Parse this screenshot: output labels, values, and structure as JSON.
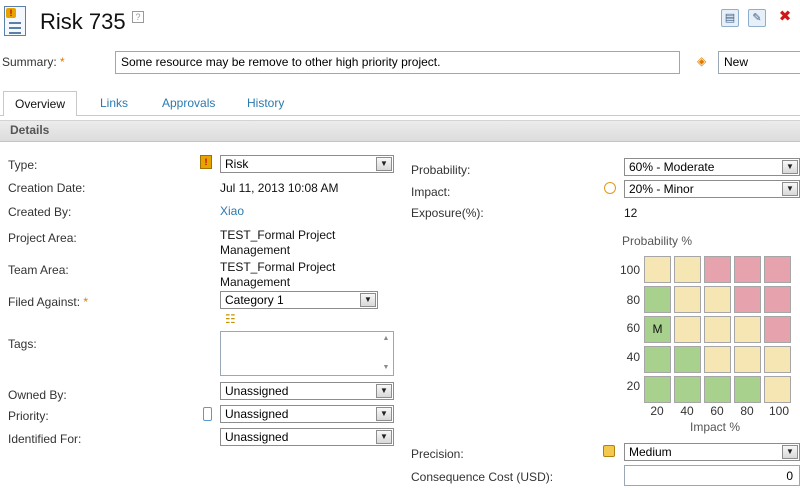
{
  "header": {
    "title": "Risk 735",
    "help_glyph": "?"
  },
  "toolbar": {
    "print_glyph": "▤",
    "edit_glyph": "✎",
    "delete_glyph": "✖"
  },
  "summary": {
    "label": "Summary:",
    "required_marker": "*",
    "value": "Some resource may be remove to other high priority project."
  },
  "state": {
    "value": "New"
  },
  "tabs": [
    {
      "label": "Overview",
      "active": true
    },
    {
      "label": "Links"
    },
    {
      "label": "Approvals"
    },
    {
      "label": "History"
    }
  ],
  "details": {
    "section_title": "Details",
    "type": {
      "label": "Type:",
      "value": "Risk"
    },
    "creation_date": {
      "label": "Creation Date:",
      "value": "Jul 11, 2013 10:08 AM"
    },
    "created_by": {
      "label": "Created By:",
      "value": "Xiao"
    },
    "project_area": {
      "label": "Project Area:",
      "value_line1": "TEST_Formal Project",
      "value_line2": "Management"
    },
    "team_area": {
      "label": "Team Area:",
      "value_line1": "TEST_Formal Project",
      "value_line2": "Management"
    },
    "filed_against": {
      "label": "Filed Against:",
      "required_marker": "*",
      "value": "Category 1"
    },
    "tags": {
      "label": "Tags:",
      "value": ""
    },
    "owned_by": {
      "label": "Owned By:",
      "value": "Unassigned"
    },
    "priority": {
      "label": "Priority:",
      "value": "Unassigned"
    },
    "identified_for": {
      "label": "Identified For:",
      "value": "Unassigned"
    }
  },
  "risk": {
    "probability": {
      "label": "Probability:",
      "value": "60% - Moderate"
    },
    "impact": {
      "label": "Impact:",
      "value": "20% - Minor"
    },
    "exposure": {
      "label": "Exposure(%):",
      "value": "12"
    },
    "matrix": {
      "title": "Probability %",
      "xlabel": "Impact %",
      "y_ticks": [
        "100",
        "80",
        "60",
        "40",
        "20"
      ],
      "x_ticks": [
        "20",
        "40",
        "60",
        "80",
        "100"
      ],
      "marker": "M",
      "marker_row": 2,
      "marker_col": 0,
      "rows": [
        [
          "yellow",
          "yellow",
          "red",
          "red",
          "red"
        ],
        [
          "green",
          "yellow",
          "yellow",
          "red",
          "red"
        ],
        [
          "green",
          "yellow",
          "yellow",
          "yellow",
          "red"
        ],
        [
          "green",
          "green",
          "yellow",
          "yellow",
          "yellow"
        ],
        [
          "green",
          "green",
          "green",
          "green",
          "yellow"
        ]
      ],
      "colors": {
        "green": "#a9d18e",
        "yellow": "#f5e6b3",
        "red": "#e6a3ad"
      }
    },
    "precision": {
      "label": "Precision:",
      "value": "Medium"
    },
    "consequence_cost": {
      "label": "Consequence Cost (USD):",
      "value": "0"
    }
  }
}
